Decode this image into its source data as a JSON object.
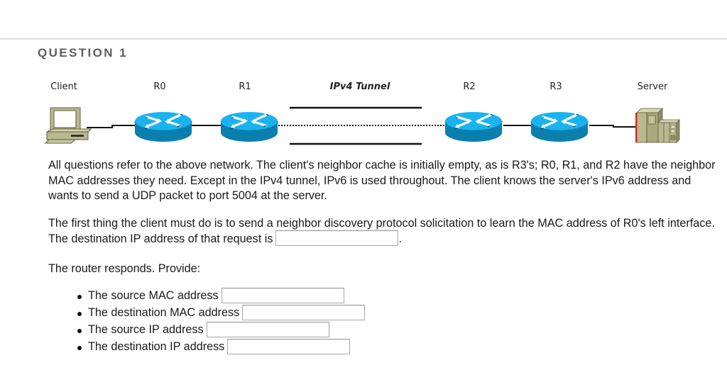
{
  "question": {
    "title": "QUESTION 1"
  },
  "diagram": {
    "nodes": [
      {
        "id": "client",
        "label": "Client",
        "type": "workstation-icon"
      },
      {
        "id": "r0",
        "label": "R0",
        "type": "router-icon"
      },
      {
        "id": "r1",
        "label": "R1",
        "type": "router-icon"
      },
      {
        "id": "r2",
        "label": "R2",
        "type": "router-icon"
      },
      {
        "id": "r3",
        "label": "R3",
        "type": "router-icon"
      },
      {
        "id": "server",
        "label": "Server",
        "type": "server-icon"
      }
    ],
    "tunnel_label": "IPv4 Tunnel",
    "links": [
      {
        "from": "client",
        "to": "r0",
        "style": "solid"
      },
      {
        "from": "r0",
        "to": "r1",
        "style": "solid"
      },
      {
        "from": "r1",
        "to": "r2",
        "style": "dotted",
        "note": "IPv4 Tunnel"
      },
      {
        "from": "r2",
        "to": "r3",
        "style": "solid"
      },
      {
        "from": "r3",
        "to": "server",
        "style": "solid"
      }
    ],
    "colors": {
      "router_top": "#19b4f0",
      "router_side": "#0a7fae",
      "device_body": "#b9b98f",
      "server_accent": "#e02020"
    }
  },
  "body": {
    "paragraph1": "All questions refer to the above network. The client's neighbor cache is initially empty, as is R3's; R0, R1, and R2 have the neighbor MAC addresses they need. Except in the IPv4 tunnel, IPv6 is used throughout. The client knows the server's IPv6 address and wants to send a UDP packet to port 5004 at the server.",
    "paragraph2_before": "The first thing the client must do is to send a neighbor discovery protocol solicitation to learn the MAC address of R0's left interface. The destination IP address of that request is",
    "paragraph2_after": ".",
    "dest_ip_input_value": "",
    "paragraph3": "The router responds. Provide:"
  },
  "answers": [
    {
      "label": "The source MAC address",
      "value": ""
    },
    {
      "label": "The destination MAC address",
      "value": ""
    },
    {
      "label": "The source IP address",
      "value": ""
    },
    {
      "label": "The destination IP address",
      "value": ""
    }
  ]
}
